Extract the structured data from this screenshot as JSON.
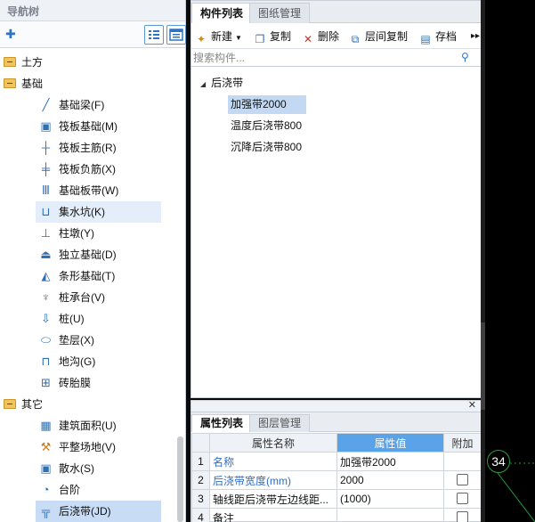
{
  "nav": {
    "title": "导航树",
    "groups": [
      {
        "label": "土方",
        "items": []
      },
      {
        "label": "基础",
        "items": [
          {
            "label": "基础梁(F)",
            "icon": "beam-icon"
          },
          {
            "label": "筏板基础(M)",
            "icon": "raft-icon"
          },
          {
            "label": "筏板主筋(R)",
            "icon": "rebar-main-icon"
          },
          {
            "label": "筏板负筋(X)",
            "icon": "rebar-neg-icon"
          },
          {
            "label": "基础板带(W)",
            "icon": "strip-icon"
          },
          {
            "label": "集水坑(K)",
            "icon": "sump-icon"
          },
          {
            "label": "柱墩(Y)",
            "icon": "pier-icon"
          },
          {
            "label": "独立基础(D)",
            "icon": "isolated-footing-icon"
          },
          {
            "label": "条形基础(T)",
            "icon": "strip-footing-icon"
          },
          {
            "label": "桩承台(V)",
            "icon": "pile-cap-icon"
          },
          {
            "label": "桩(U)",
            "icon": "pile-icon"
          },
          {
            "label": "垫层(X)",
            "icon": "cushion-icon"
          },
          {
            "label": "地沟(G)",
            "icon": "trench-icon"
          },
          {
            "label": "砖胎膜",
            "icon": "brick-form-icon"
          }
        ]
      },
      {
        "label": "其它",
        "items": [
          {
            "label": "建筑面积(U)",
            "icon": "area-icon"
          },
          {
            "label": "平整场地(V)",
            "icon": "site-leveling-icon"
          },
          {
            "label": "散水(S)",
            "icon": "apron-icon"
          },
          {
            "label": "台阶",
            "icon": "steps-icon"
          },
          {
            "label": "后浇带(JD)",
            "icon": "post-cast-strip-icon"
          }
        ]
      }
    ]
  },
  "components": {
    "tabs": [
      "构件列表",
      "图纸管理"
    ],
    "toolbar": {
      "new": "新建",
      "copy": "复制",
      "delete": "删除",
      "floor_copy": "层间复制",
      "save": "存档"
    },
    "search_placeholder": "搜索构件...",
    "root": "后浇带",
    "items": [
      "加强带2000",
      "温度后浇带800",
      "沉降后浇带800"
    ]
  },
  "properties": {
    "tabs": [
      "属性列表",
      "图层管理"
    ],
    "columns": [
      "属性名称",
      "属性值",
      "附加"
    ],
    "rows": [
      {
        "n": "1",
        "name": "名称",
        "value": "加强带2000",
        "check": false
      },
      {
        "n": "2",
        "name": "后浇带宽度(mm)",
        "value": "2000",
        "check": true
      },
      {
        "n": "3",
        "name": "轴线距后浇带左边线距...",
        "value": "(1000)",
        "check": true
      },
      {
        "n": "4",
        "name": "备注",
        "value": "",
        "check": true
      }
    ]
  },
  "canvas": {
    "marker": "34"
  },
  "colors": {
    "accent": "#2f73c6",
    "selection": "#c3d9f3",
    "header_highlight": "#5aa3e8"
  }
}
